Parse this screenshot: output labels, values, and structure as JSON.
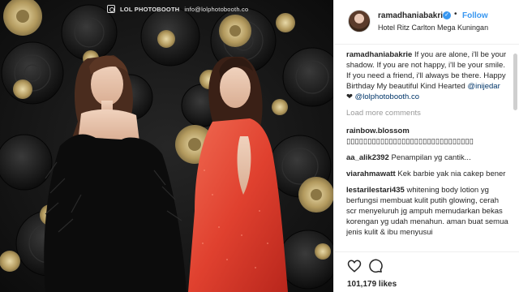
{
  "photo": {
    "watermark_brand": "LOL PHOTOBOOTH",
    "watermark_email": "info@lolphotobooth.co"
  },
  "post": {
    "username": "ramadhaniabakrie",
    "follow_label": "Follow",
    "location": "Hotel Ritz Carlton Mega Kuningan",
    "caption": {
      "user": "ramadhaniabakrie",
      "text": "If you are alone, i'll be your shadow. If you are not happy, i'll be your smile. If you need a friend, i'll always be there. Happy Birthday My beautiful Kind Hearted",
      "mention1": "@inijedar",
      "heart": "❤",
      "mention2": "@lolphotobooth.co"
    },
    "load_more_label": "Load more comments",
    "comments": [
      {
        "user": "rainbow.blossom",
        "text": "▯▯▯▯▯▯▯▯▯▯▯▯▯▯▯▯▯▯▯▯▯▯▯▯▯▯▯▯▯▯"
      },
      {
        "user": "aa_alik2392",
        "text": "Penampilan yg cantik..."
      },
      {
        "user": "viarahmawatt",
        "text": "Kek barbie yak nia cakep bener"
      },
      {
        "user": "lestarilestari435",
        "text": "whitening body lotion yg berfungsi membuat kulit putih glowing, cerah scr menyeluruh jg ampuh memudarkan bekas korengan yg udah menahun. aman buat semua jenis kulit & ibu menyusui"
      }
    ],
    "likes": "101,179 likes"
  },
  "colors": {
    "accent": "#3897f0",
    "mention": "#003569",
    "dress_red": "#e8503f",
    "gold_flower": "#c8b27a"
  },
  "icons": [
    "verified-badge-icon",
    "heart-icon",
    "comment-icon",
    "photobooth-logo-icon"
  ]
}
